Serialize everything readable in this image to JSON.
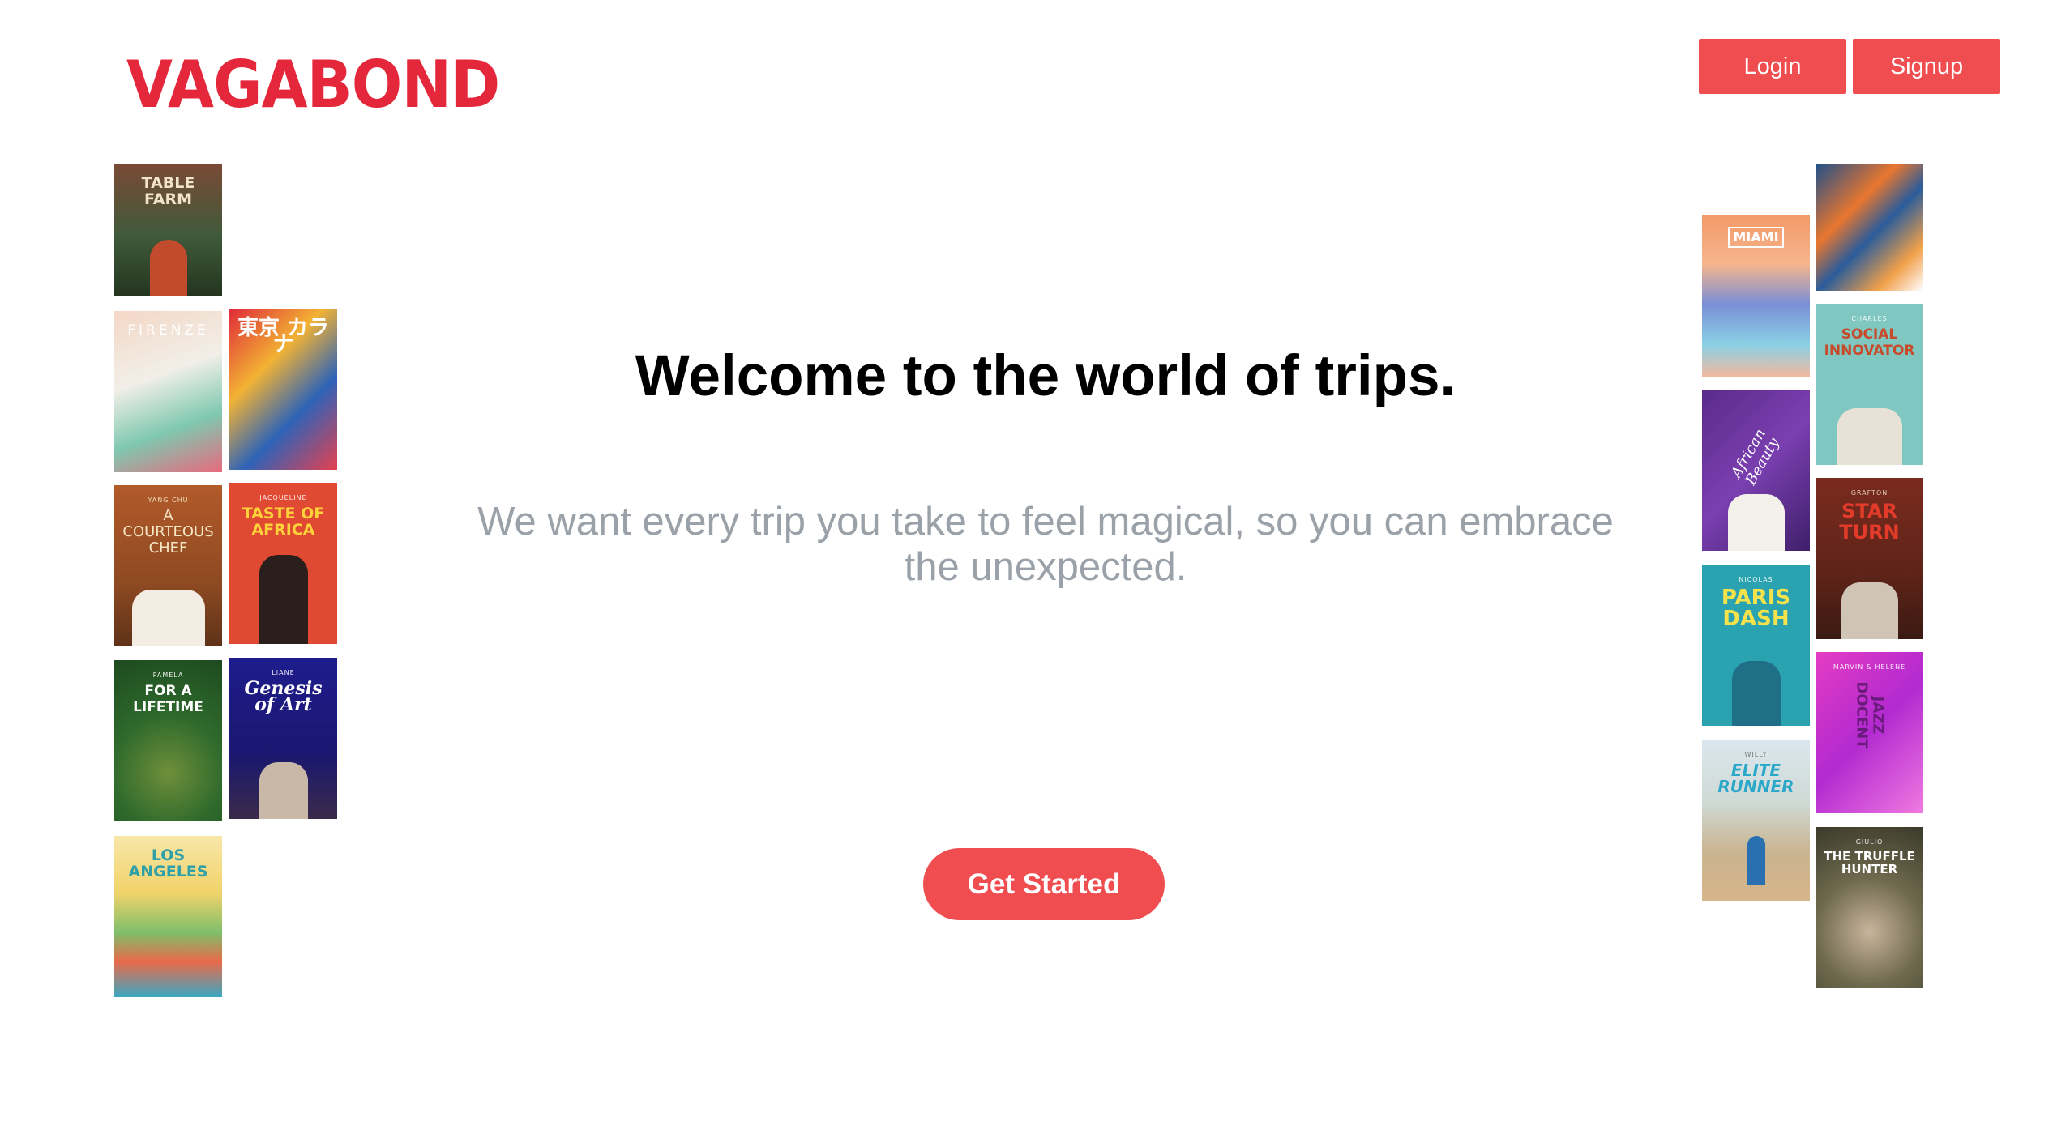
{
  "header": {
    "logo": "VAGABOND",
    "login_label": "Login",
    "signup_label": "Signup"
  },
  "hero": {
    "headline": "Welcome to the world of trips.",
    "subheadline": "We want every trip you take to feel magical, so you can embrace the unexpected.",
    "cta_label": "Get Started"
  },
  "colors": {
    "brand": "#e5273b",
    "button": "#ef4d50",
    "subtext": "#9aa1a8"
  },
  "covers_left": [
    {
      "kicker": "",
      "title": "TABLE FARM"
    },
    {
      "kicker": "",
      "title": "FIRENZE"
    },
    {
      "kicker": "",
      "title": "東京 カラナ"
    },
    {
      "kicker": "YANG CHU",
      "title": "A COURTEOUS CHEF"
    },
    {
      "kicker": "JACQUELINE",
      "title": "TASTE OF AFRICA"
    },
    {
      "kicker": "PAMELA",
      "title": "FOR A LIFETIME"
    },
    {
      "kicker": "LIANE",
      "title": "Genesis of Art"
    },
    {
      "kicker": "",
      "title": "LOS ANGELES"
    }
  ],
  "covers_right": [
    {
      "kicker": "",
      "title": ""
    },
    {
      "kicker": "",
      "title": "MIAMI"
    },
    {
      "kicker": "CHARLES",
      "title": "SOCIAL INNOVATOR"
    },
    {
      "kicker": "",
      "title": "African Beauty"
    },
    {
      "kicker": "GRAFTON",
      "title": "STAR TURN"
    },
    {
      "kicker": "NICOLAS",
      "title": "PARIS DASH"
    },
    {
      "kicker": "MARVIN & HELENE",
      "title": "JAZZ DOCENT"
    },
    {
      "kicker": "WILLY",
      "title": "ELITE RUNNER"
    },
    {
      "kicker": "GIULIO",
      "title": "THE TRUFFLE HUNTER"
    }
  ]
}
